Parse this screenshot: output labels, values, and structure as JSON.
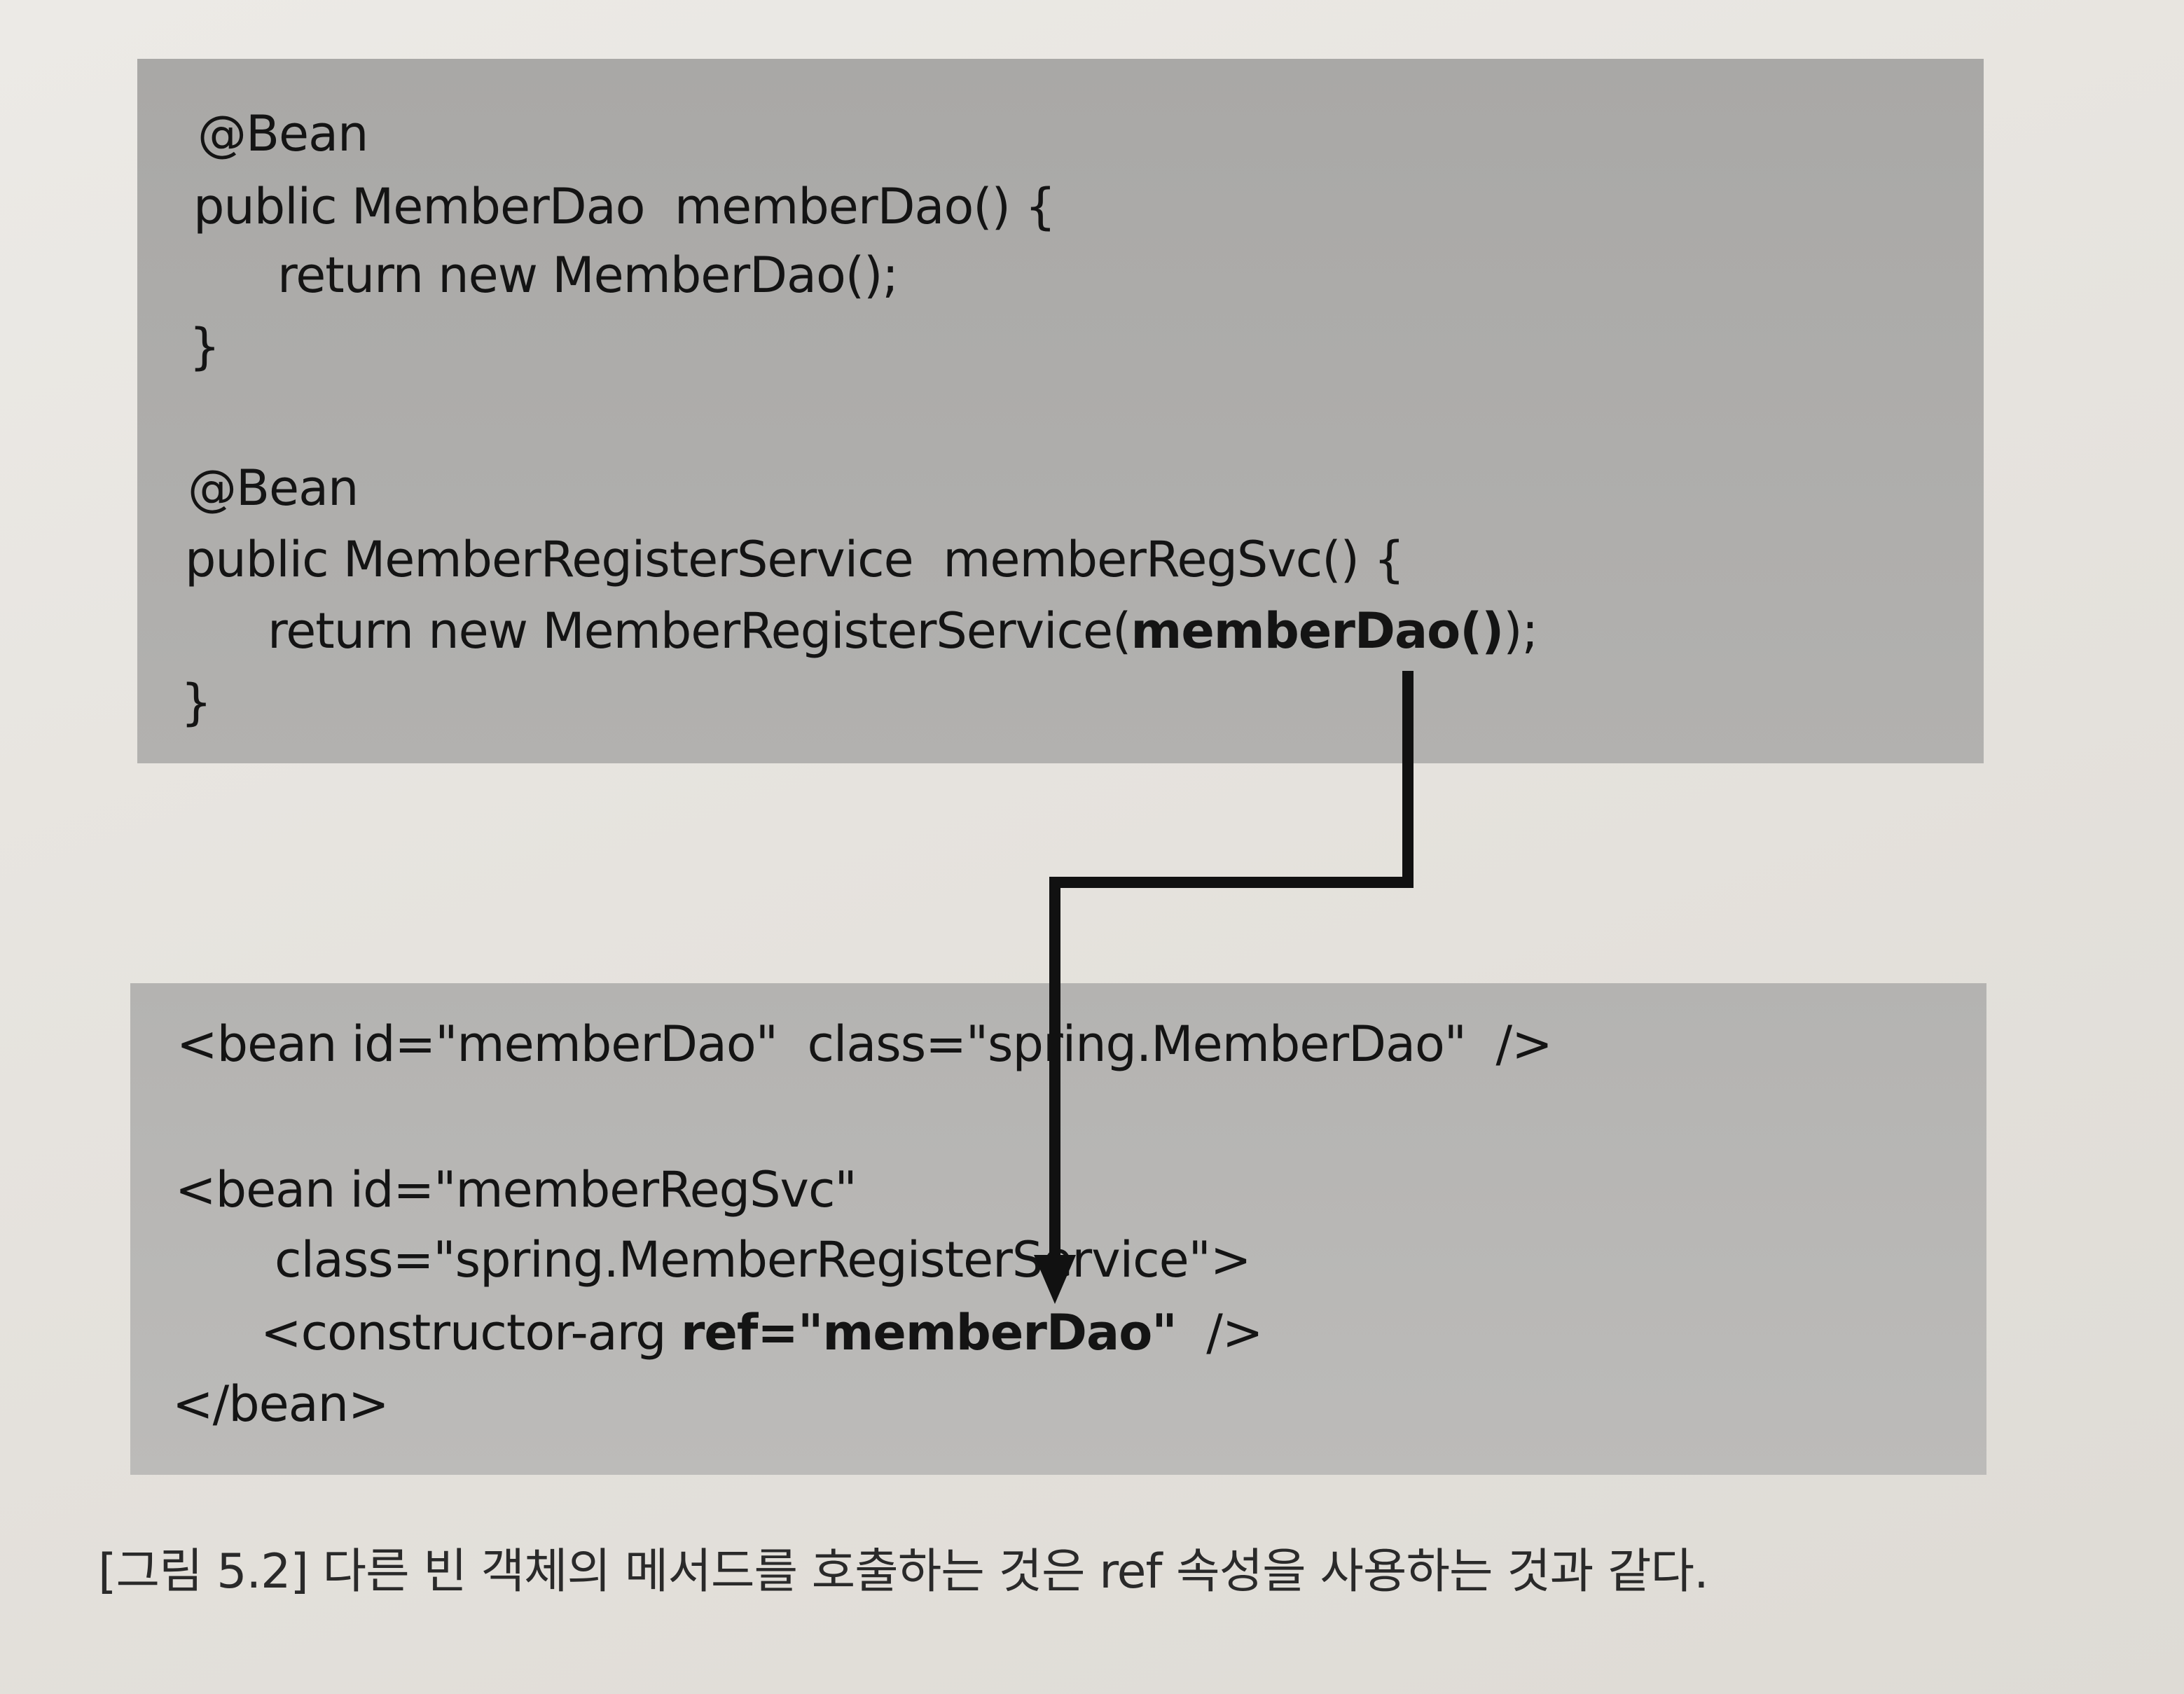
{
  "java_code": {
    "lines": [
      "@Bean",
      "public MemberDao  memberDao() {",
      "return new MemberDao();",
      "}",
      "@Bean",
      "public MemberRegisterService  memberRegSvc() {",
      "return new MemberRegisterService(",
      "memberDao()",
      ");",
      "}"
    ]
  },
  "xml_code": {
    "lines": [
      "<bean id=\"memberDao\"  class=\"spring.MemberDao\"  />",
      "<bean id=\"memberRegSvc\"",
      "class=\"spring.MemberRegisterService\">",
      "<constructor-arg ",
      "ref=\"memberDao\"",
      "  />",
      "</bean>"
    ]
  },
  "caption": "[그림 5.2] 다른 빈 객체의 메서드를 호출하는 것은 ref 속성을 사용하는 것과 같다."
}
